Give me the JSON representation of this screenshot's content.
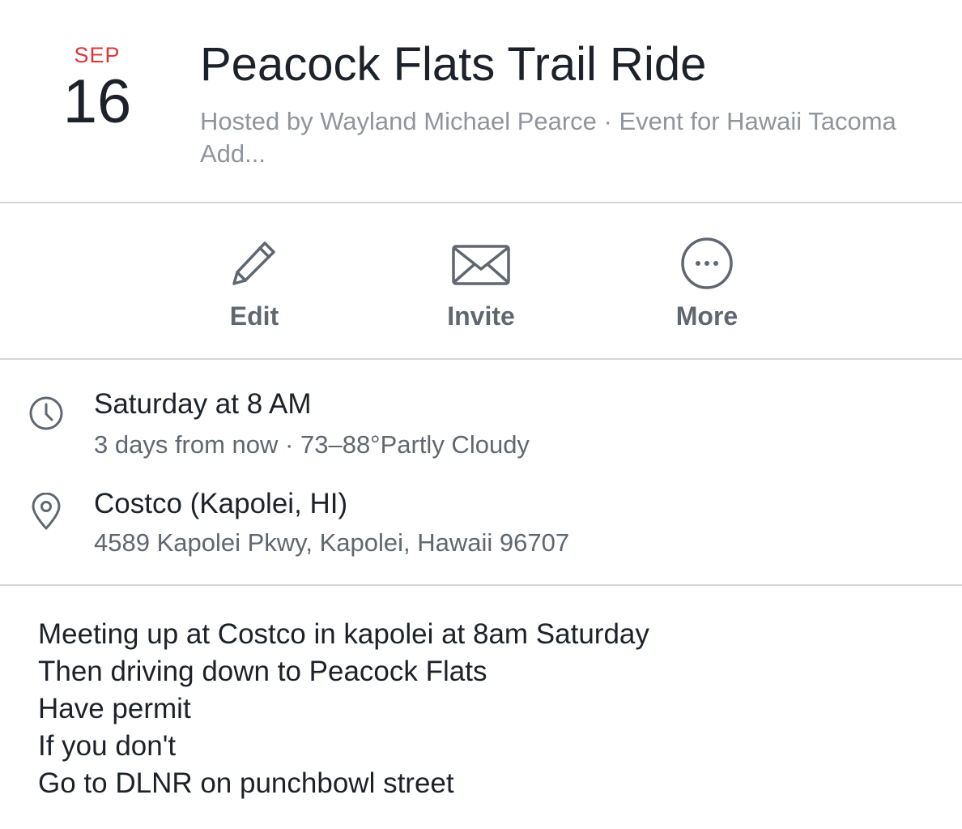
{
  "event": {
    "month": "SEP",
    "day": "16",
    "title": "Peacock Flats Trail Ride",
    "host_line": "Hosted by Wayland Michael Pearce · Event for Hawaii Tacoma Add..."
  },
  "actions": [
    {
      "label": "Edit",
      "icon": "pencil-icon"
    },
    {
      "label": "Invite",
      "icon": "envelope-icon"
    },
    {
      "label": "More",
      "icon": "more-icon"
    }
  ],
  "details": {
    "time": {
      "icon": "clock-icon",
      "main": "Saturday at 8 AM",
      "sub": "3 days from now · 73–88°Partly Cloudy"
    },
    "location": {
      "icon": "location-pin-icon",
      "main": "Costco (Kapolei, HI)",
      "sub": "4589 Kapolei Pkwy, Kapolei, Hawaii 96707"
    }
  },
  "description": [
    "Meeting up at Costco in kapolei at 8am Saturday",
    "Then driving down to Peacock Flats",
    "Have permit",
    "If you don't",
    "Go to DLNR on punchbowl street"
  ],
  "colors": {
    "month": "#d9373b",
    "secondary_text": "#90949c",
    "icon_gray": "#606770",
    "divider": "#d5d6d9"
  }
}
